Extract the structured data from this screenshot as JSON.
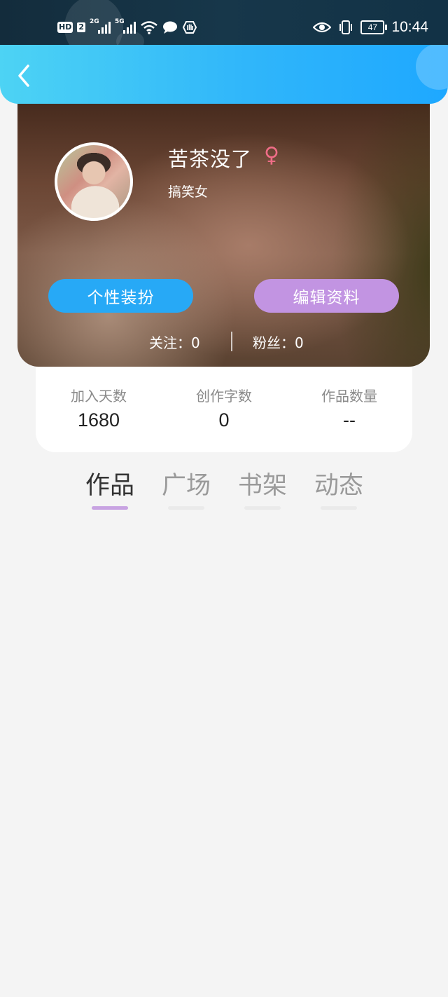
{
  "status_bar": {
    "hd_label": "HD",
    "sim_number": "2",
    "signal_1_label": "2G",
    "signal_2_label": "5G",
    "battery_level": "47",
    "time": "10:44",
    "icons": [
      "hd-icon",
      "signal-icon",
      "wifi-icon",
      "message-icon",
      "hand-icon",
      "eye-icon",
      "vibrate-icon",
      "battery-icon"
    ]
  },
  "header": {
    "back_icon": "chevron-left-icon"
  },
  "profile": {
    "name": "苦茶没了",
    "gender_symbol": "♀",
    "bio": "搞笑女",
    "dress_button": "个性装扮",
    "edit_button": "编辑资料",
    "following_label": "关注：",
    "following_value": "0",
    "fans_label": "粉丝：",
    "fans_value": "0"
  },
  "stats": [
    {
      "label": "加入天数",
      "value": "1680"
    },
    {
      "label": "创作字数",
      "value": "0"
    },
    {
      "label": "作品数量",
      "value": "--"
    }
  ],
  "tabs": [
    {
      "label": "作品",
      "active": true
    },
    {
      "label": "广场",
      "active": false
    },
    {
      "label": "书架",
      "active": false
    },
    {
      "label": "动态",
      "active": false
    }
  ],
  "colors": {
    "header_start": "#4dd3f4",
    "header_end": "#1ea8ff",
    "dress_button": "#27a9f6",
    "edit_button": "#c294e2",
    "gender": "#ef6d87",
    "tab_active_underline": "#c8a3e2"
  }
}
